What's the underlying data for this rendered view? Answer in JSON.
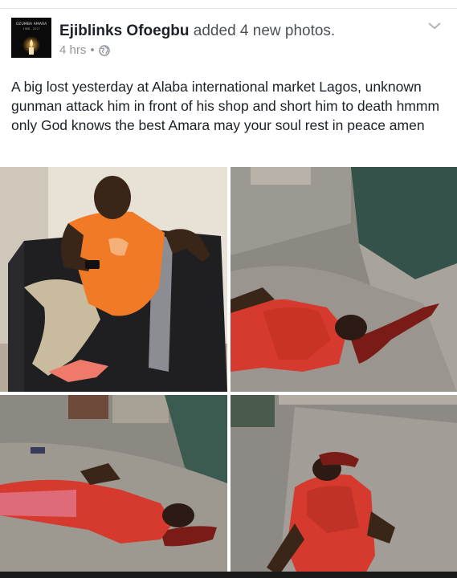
{
  "post": {
    "author": "Ejiblinks Ofoegbu",
    "action": "added 4 new photos.",
    "time": "4 hrs",
    "separator": "•",
    "privacy_icon": "globe-icon",
    "menu_icon": "chevron-down-icon",
    "avatar_caption_line1": "OZUMBA AMARA",
    "avatar_caption_line2": "1988 - 2017",
    "text": "A big lost yesterday at Alaba international market Lagos, unknown gunman attack him in front of his shop and short him to death hmmm only God knows the best Amara may your soul rest in peace amen"
  },
  "photos": [
    {
      "id": "photo-1",
      "description_icon": "photo-icon"
    },
    {
      "id": "photo-2",
      "description_icon": "photo-icon"
    },
    {
      "id": "photo-3",
      "description_icon": "photo-icon"
    },
    {
      "id": "photo-4",
      "description_icon": "photo-icon"
    }
  ],
  "colors": {
    "author": "#1d2129",
    "secondary_text": "#90949c",
    "divider": "#e3e3e3"
  }
}
